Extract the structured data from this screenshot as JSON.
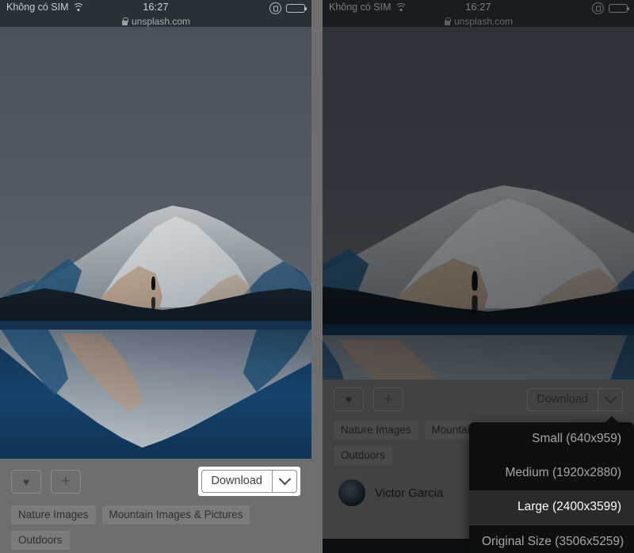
{
  "status_bar": {
    "carrier": "Không có SIM",
    "wifi_icon": "wifi-icon",
    "time": "16:27",
    "rotation_lock_icon": "rotation-lock-icon",
    "battery_icon": "battery-icon",
    "lock_icon": "lock-icon",
    "url": "unsplash.com"
  },
  "photo": {
    "alt": "snow-covered mountain reflected in an alpine lake with a lone hiker silhouette"
  },
  "actions": {
    "like_label": "♥",
    "like_icon": "heart-icon",
    "add_label": "+",
    "add_icon": "plus-icon",
    "download_label": "Download",
    "download_caret_icon": "chevron-down-icon"
  },
  "tags": [
    "Nature Images",
    "Mountain Images & Pictures",
    "Outdoors"
  ],
  "author": {
    "name": "Victor Garcia",
    "avatar_icon": "avatar"
  },
  "download_menu": {
    "items": [
      {
        "label": "Small (640x959)",
        "active": false
      },
      {
        "label": "Medium (1920x2880)",
        "active": false
      },
      {
        "label": "Large (2400x3599)",
        "active": true
      },
      {
        "label": "Original Size (3506x5259)",
        "active": false
      }
    ]
  },
  "colors": {
    "page_background": "#6e6e6e",
    "status_bar_background": "#2a3038",
    "menu_background": "#0f0f0f",
    "menu_active_background": "#2a2a2a",
    "tag_background": "#7b7b7b",
    "highlight_halo": "#ffffff"
  }
}
